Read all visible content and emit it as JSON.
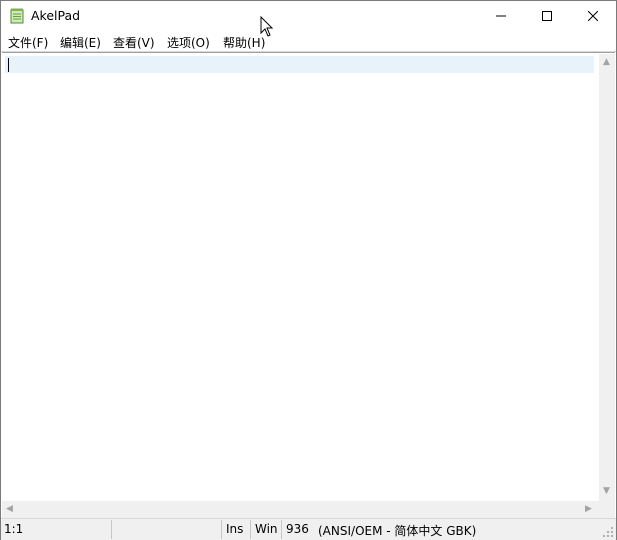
{
  "window": {
    "title": "AkelPad",
    "app_icon": "notepad-icon",
    "caption_buttons": [
      "minimize-icon",
      "maximize-icon",
      "close-icon"
    ]
  },
  "menu": {
    "items": [
      "文件(F)",
      "编辑(E)",
      "查看(V)",
      "选项(O)",
      "帮助(H)"
    ]
  },
  "editor": {
    "content": "",
    "current_line_color": "#e8f2fb"
  },
  "status": {
    "position": "1:1",
    "insert_mode": "Ins",
    "newline": "Win",
    "codepage": "936",
    "encoding": "(ANSI/OEM - 简体中文 GBK)"
  }
}
